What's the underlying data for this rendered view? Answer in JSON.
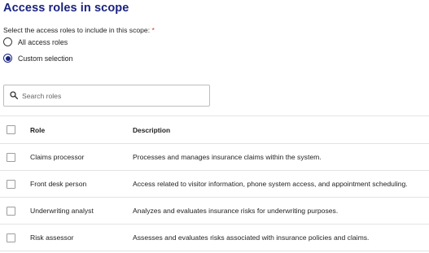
{
  "section": {
    "title": "Access roles in scope",
    "prompt": "Select the access roles to include in this scope:",
    "required_marker": "*"
  },
  "options": [
    {
      "label": "All access roles",
      "selected": false
    },
    {
      "label": "Custom selection",
      "selected": true
    }
  ],
  "search": {
    "placeholder": "Search roles",
    "value": ""
  },
  "table": {
    "headers": {
      "role": "Role",
      "description": "Description"
    },
    "rows": [
      {
        "role": "Claims processor",
        "description": "Processes and manages insurance claims within the system."
      },
      {
        "role": "Front desk person",
        "description": "Access related to visitor information, phone system access, and appointment scheduling."
      },
      {
        "role": "Underwriting analyst",
        "description": "Analyzes and evaluates insurance risks for underwriting purposes."
      },
      {
        "role": "Risk assessor",
        "description": "Assesses and evaluates risks associated with insurance policies and claims."
      }
    ]
  },
  "colors": {
    "accent": "#1a237e",
    "required": "#d32f2f",
    "border": "#e3e3e3"
  }
}
